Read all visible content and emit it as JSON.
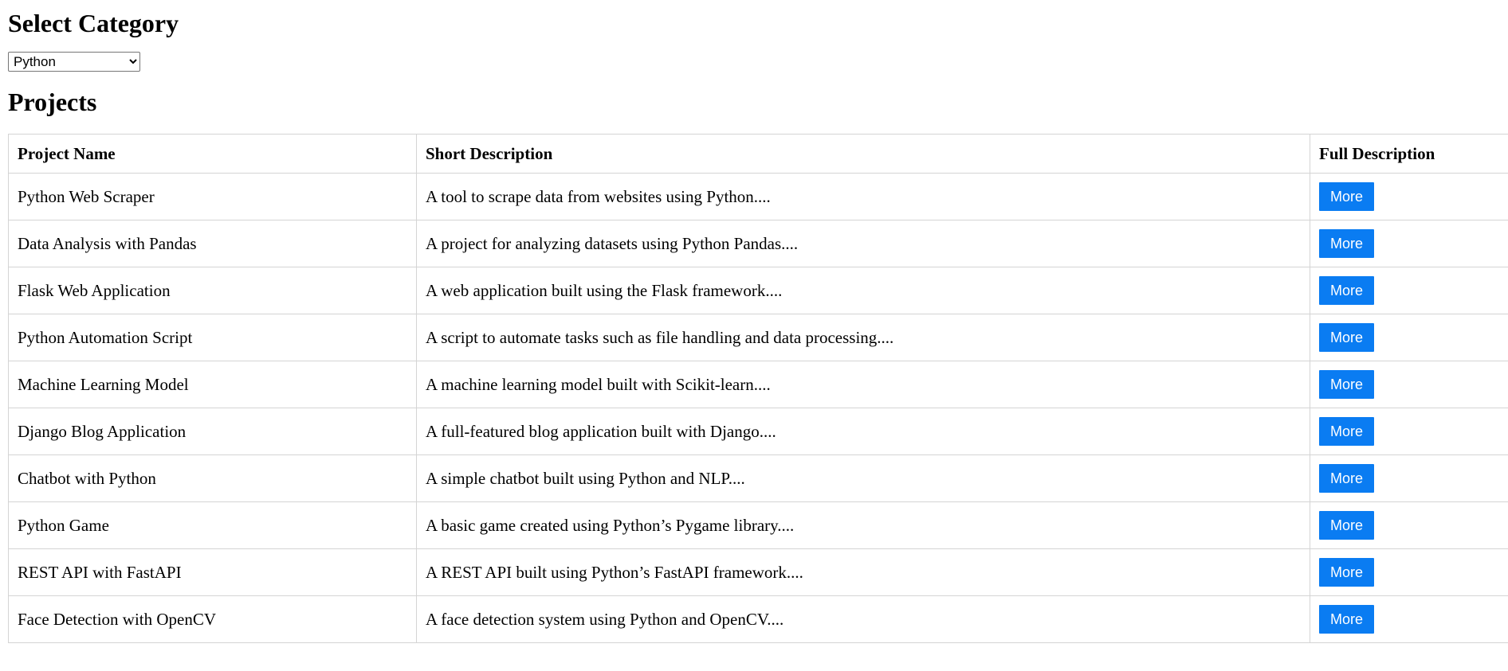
{
  "category_section": {
    "title": "Select Category",
    "selected": "Python"
  },
  "projects_section": {
    "title": "Projects",
    "columns": [
      "Project Name",
      "Short Description",
      "Full Description"
    ],
    "more_label": "More",
    "rows": [
      {
        "name": "Python Web Scraper",
        "short": "A tool to scrape data from websites using Python...."
      },
      {
        "name": "Data Analysis with Pandas",
        "short": "A project for analyzing datasets using Python Pandas...."
      },
      {
        "name": "Flask Web Application",
        "short": "A web application built using the Flask framework...."
      },
      {
        "name": "Python Automation Script",
        "short": "A script to automate tasks such as file handling and data processing...."
      },
      {
        "name": "Machine Learning Model",
        "short": "A machine learning model built with Scikit-learn...."
      },
      {
        "name": "Django Blog Application",
        "short": "A full-featured blog application built with Django...."
      },
      {
        "name": "Chatbot with Python",
        "short": "A simple chatbot built using Python and NLP...."
      },
      {
        "name": "Python Game",
        "short": "A basic game created using Python’s Pygame library...."
      },
      {
        "name": "REST API with FastAPI",
        "short": "A REST API built using Python’s FastAPI framework...."
      },
      {
        "name": "Face Detection with OpenCV",
        "short": "A face detection system using Python and OpenCV...."
      }
    ]
  },
  "colors": {
    "button": "#0a7cf2",
    "border": "#d4d4d4"
  }
}
